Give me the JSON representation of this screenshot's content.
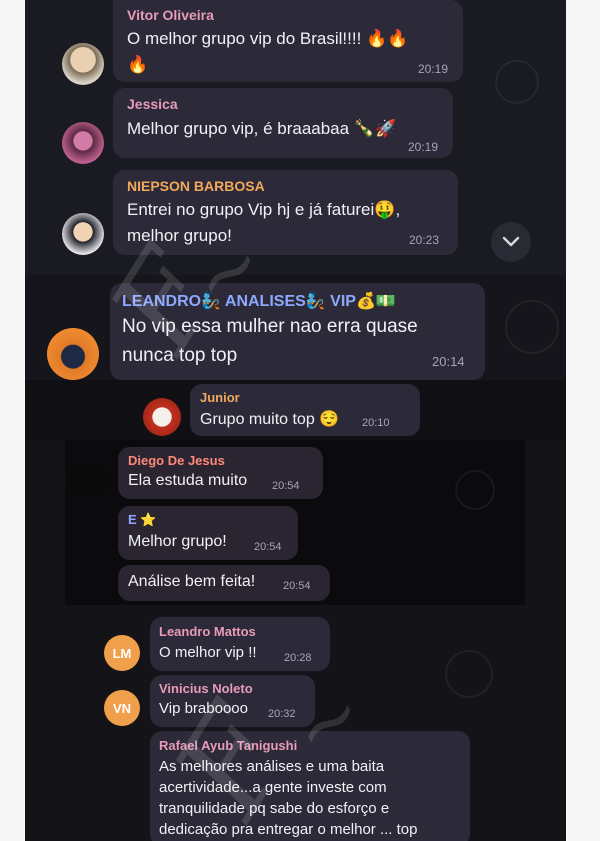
{
  "messages": [
    {
      "sender": "Vitor Oliveira",
      "text_line1": "O melhor grupo vip do Brasil!!!! 🔥🔥",
      "text_line2": "🔥",
      "time": "20:19"
    },
    {
      "sender": "Jessica",
      "text": "Melhor grupo vip, é braaabaa 🍾🚀",
      "time": "20:19"
    },
    {
      "sender": "NIEPSON BARBOSA",
      "text_line1": "Entrei no grupo Vip hj e já faturei🤑,",
      "text_line2": "melhor grupo!",
      "time": "20:23"
    },
    {
      "sender": "LEANDRO🧞 ANALISES🧞 VIP💰💵",
      "text_line1": "No vip essa mulher nao erra quase",
      "text_line2": "nunca top top",
      "time": "20:14"
    },
    {
      "sender": "Junior",
      "text": "Grupo muito top 😌",
      "time": "20:10"
    },
    {
      "sender": "Diego De Jesus",
      "text": "Ela estuda muito",
      "time": "20:54"
    },
    {
      "sender": "E ⭐",
      "text": "Melhor grupo!",
      "time": "20:54"
    },
    {
      "sender": "",
      "text": "Análise bem feita!",
      "time": "20:54"
    },
    {
      "sender": "Leandro Mattos",
      "avatar_initials": "LM",
      "text": "O melhor  vip  !!",
      "time": "20:28"
    },
    {
      "sender": "Vinicius Noleto",
      "avatar_initials": "VN",
      "text": "Vip braboooo",
      "time": "20:32"
    },
    {
      "sender": "Rafael Ayub Tanigushi",
      "lines": [
        "As melhores análises e uma baita",
        "acertividade...a gente investe com",
        "tranquilidade pq sabe do esforço e",
        "dedicação pra entregar o melhor ... top"
      ]
    }
  ],
  "colors": {
    "name_pink": "#e89bb8",
    "name_orange": "#f0a85a",
    "name_blue": "#8fa8ff",
    "name_red": "#ff8a7a",
    "avatar_orange": "#f0a04a"
  },
  "icons": {
    "scroll_down": "chevron-down-icon"
  }
}
